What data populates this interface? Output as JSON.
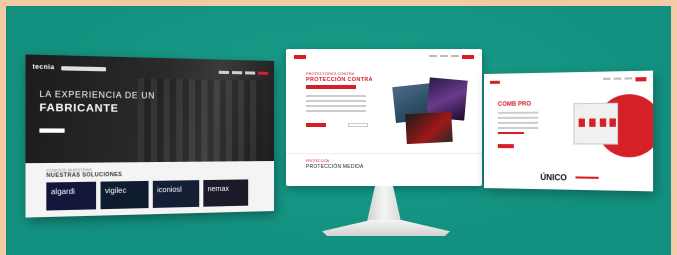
{
  "left_screen": {
    "logo": "tecnia",
    "hero_line1": "LA EXPERIENCIA DE UN",
    "hero_line2": "FABRICANTE",
    "section_eyebrow": "CONOCE NUESTRAS",
    "section_title": "NUESTRAS SOLUCIONES",
    "cards": [
      "algardi",
      "vigilec",
      "iconiosl",
      "nemax"
    ]
  },
  "monitor": {
    "eyebrow": "PROTECTORES CONTRA",
    "headline": "PROTECCIÓN CONTRA",
    "footer_eyebrow": "PROTECCIÓN",
    "footer_title": "PROTECCIÓN MEDIDA"
  },
  "right_screen": {
    "title": "COMB PRO",
    "tagline": "ÚNICO"
  },
  "colors": {
    "background": "#12907f",
    "border": "#f3c9a6",
    "accent": "#d42026"
  }
}
